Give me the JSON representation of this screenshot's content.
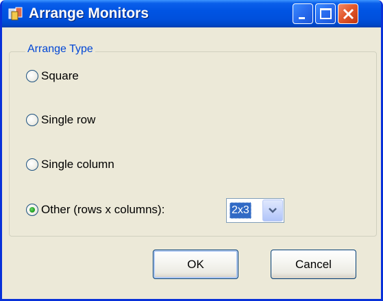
{
  "window": {
    "title": "Arrange Monitors",
    "icon": "arrange-monitors-app-icon",
    "controls": [
      "minimize-icon",
      "maximize-icon",
      "close-icon"
    ]
  },
  "group": {
    "legend": "Arrange Type",
    "options": [
      {
        "label": "Square",
        "checked": false
      },
      {
        "label": "Single row",
        "checked": false
      },
      {
        "label": "Single column",
        "checked": false
      },
      {
        "label": "Other (rows x columns):",
        "checked": true
      }
    ],
    "layout_select": {
      "value": "2x3"
    }
  },
  "buttons": {
    "ok": "OK",
    "cancel": "Cancel"
  },
  "colors": {
    "title_bar": "#0054e3",
    "dialog_bg": "#ece9d8",
    "legend_text": "#0046d5",
    "selection": "#316ac5",
    "close_button": "#e35a2c"
  }
}
